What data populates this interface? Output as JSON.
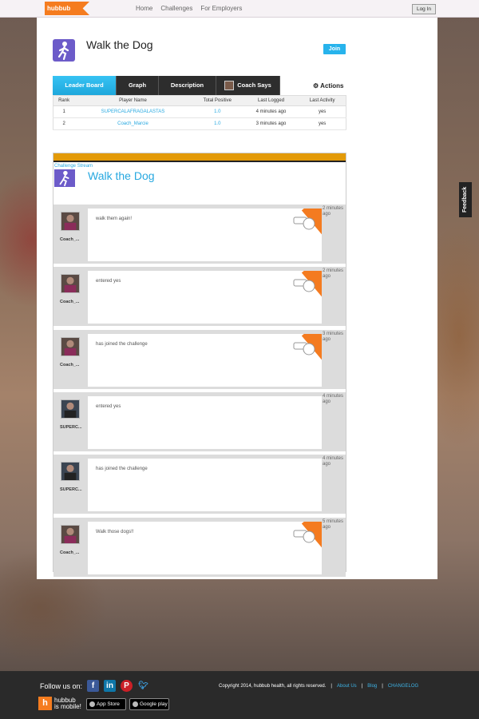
{
  "topbar": {
    "logo": "hubbub",
    "nav": [
      "Home",
      "Challenges",
      "For Employers"
    ],
    "login": "Log In"
  },
  "challenge": {
    "title": "Walk the Dog",
    "join": "Join"
  },
  "tabs": [
    {
      "label": "Leader Board",
      "active": true
    },
    {
      "label": "Graph"
    },
    {
      "label": "Description"
    },
    {
      "label": "Coach Says"
    }
  ],
  "actions_label": "Actions",
  "leaderboard": {
    "headers": [
      "Rank",
      "Player Name",
      "Total Positive",
      "Last Logged",
      "Last Activity"
    ],
    "rows": [
      [
        "1",
        "SUPERCALAFRAGALASTAS",
        "1.0",
        "4 minutes ago",
        "yes"
      ],
      [
        "2",
        "Coach_Marcie",
        "1.0",
        "3 minutes ago",
        "yes"
      ]
    ]
  },
  "stream": {
    "label": "Challenge Stream",
    "title": "Walk the Dog",
    "posts": [
      {
        "name": "Coach_...",
        "message": "walk them again!",
        "time": "2 minutes ago",
        "coach": true
      },
      {
        "name": "Coach_...",
        "message": "entered yes",
        "time": "2 minutes ago",
        "coach": true
      },
      {
        "name": "Coach_...",
        "message": "has joined the challenge",
        "time": "3 minutes ago",
        "coach": true
      },
      {
        "name": "SUPERC...",
        "message": "entered yes",
        "time": "4 minutes ago",
        "coach": false
      },
      {
        "name": "SUPERC...",
        "message": "has joined the challenge",
        "time": "4 minutes ago",
        "coach": false
      },
      {
        "name": "Coach_...",
        "message": "Walk those dogs!!",
        "time": "5 minutes ago",
        "coach": true
      }
    ]
  },
  "feedback": "Feedback",
  "footer": {
    "follow": "Follow us on:",
    "copyright": "Copyright 2014, hubbub health, all rights reserved.",
    "links": [
      "About Us",
      "Blog",
      "CHANGELOG"
    ],
    "mobile_line1": "hubbub",
    "mobile_line2": "is mobile!",
    "appstore": "App Store",
    "googleplay": "Google play"
  },
  "colors": {
    "accent": "#27b3ec",
    "brand_orange": "#f57c1f",
    "stream_bar": "#e39a08"
  }
}
